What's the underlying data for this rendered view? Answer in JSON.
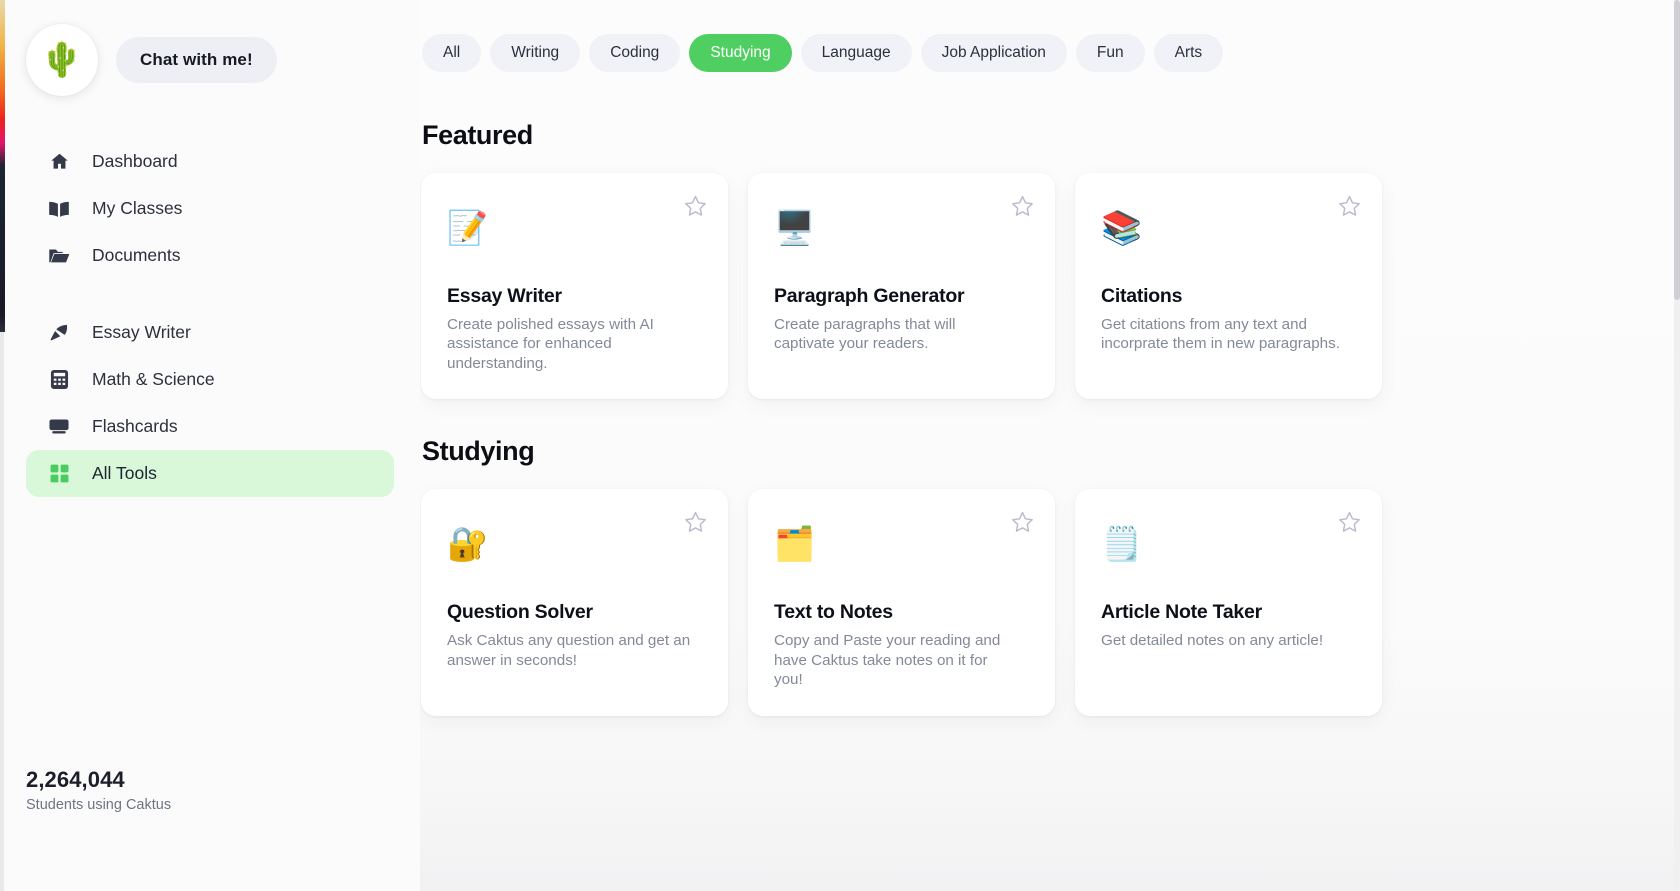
{
  "brand": {
    "logo_icon": "cactus-icon",
    "logo_glyph": "🌵",
    "chat_button_label": "Chat with me!"
  },
  "sidebar": {
    "groups": [
      {
        "items": [
          {
            "label": "Dashboard",
            "icon": "home-icon",
            "active": false
          },
          {
            "label": "My Classes",
            "icon": "book-icon",
            "active": false
          },
          {
            "label": "Documents",
            "icon": "folder-icon",
            "active": false
          }
        ]
      },
      {
        "items": [
          {
            "label": "Essay Writer",
            "icon": "pen-nib-icon",
            "active": false
          },
          {
            "label": "Math & Science",
            "icon": "calculator-icon",
            "active": false
          },
          {
            "label": "Flashcards",
            "icon": "cards-icon",
            "active": false
          },
          {
            "label": "All Tools",
            "icon": "grid-icon",
            "active": true
          }
        ]
      }
    ],
    "stats": {
      "count": "2,264,044",
      "caption": "Students using Caktus"
    }
  },
  "filters": {
    "chips": [
      {
        "label": "All",
        "active": false
      },
      {
        "label": "Writing",
        "active": false
      },
      {
        "label": "Coding",
        "active": false
      },
      {
        "label": "Studying",
        "active": true
      },
      {
        "label": "Language",
        "active": false
      },
      {
        "label": "Job Application",
        "active": false
      },
      {
        "label": "Fun",
        "active": false
      },
      {
        "label": "Arts",
        "active": false
      }
    ]
  },
  "sections": [
    {
      "title": "Featured",
      "cards": [
        {
          "title": "Essay Writer",
          "desc": "Create polished essays with AI assistance for enhanced understanding.",
          "icon": "document-pencil-icon",
          "glyph": "📝",
          "favorite_icon": "star-outline-icon"
        },
        {
          "title": "Paragraph Generator",
          "desc": "Create paragraphs that will captivate your readers.",
          "icon": "monitor-pencil-icon",
          "glyph": "🖥️",
          "favorite_icon": "star-outline-icon"
        },
        {
          "title": "Citations",
          "desc": "Get citations from any text and incorprate them in new paragraphs.",
          "icon": "citation-blocks-icon",
          "glyph": "📚",
          "favorite_icon": "star-outline-icon"
        }
      ]
    },
    {
      "title": "Studying",
      "cards": [
        {
          "title": "Question Solver",
          "desc": "Ask Caktus any question and get an answer in seconds!",
          "icon": "gold-lock-icon",
          "glyph": "🔐",
          "favorite_icon": "star-outline-icon"
        },
        {
          "title": "Text to Notes",
          "desc": "Copy and Paste your reading and have Caktus take notes on it for you!",
          "icon": "blue-notes-icon",
          "glyph": "🗂️",
          "favorite_icon": "star-outline-icon"
        },
        {
          "title": "Article Note Taker",
          "desc": "Get detailed notes on any article!",
          "icon": "notepad-icon",
          "glyph": "🗒️",
          "favorite_icon": "star-outline-icon"
        }
      ]
    }
  ],
  "colors": {
    "accent_green": "#4fcf61",
    "active_nav_bg": "#d9f7d9",
    "chip_bg": "#f1f2f7",
    "page_bg": "#fbfbfb",
    "card_bg": "#ffffff",
    "title_color": "#0c0e14",
    "muted_text": "#838997"
  }
}
